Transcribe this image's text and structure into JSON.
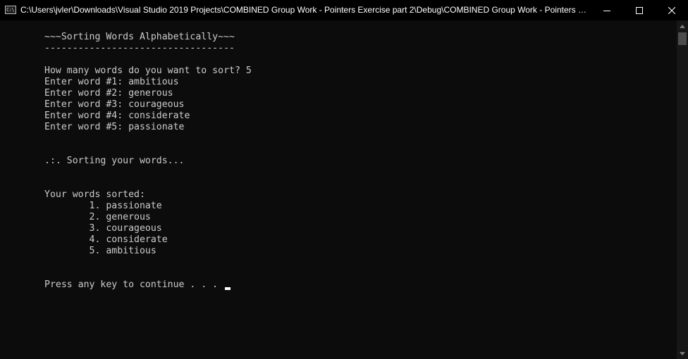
{
  "window": {
    "title": "C:\\Users\\jvler\\Downloads\\Visual Studio 2019 Projects\\COMBINED Group Work - Pointers Exercise part 2\\Debug\\COMBINED Group Work - Pointers Exer...",
    "icon_text": "C:\\",
    "minimize_icon": "minimize-icon",
    "maximize_icon": "maximize-icon",
    "close_icon": "close-icon"
  },
  "console": {
    "lines": [
      "~~~Sorting Words Alphabetically~~~",
      "----------------------------------",
      "",
      "How many words do you want to sort? 5",
      "Enter word #1: ambitious",
      "Enter word #2: generous",
      "Enter word #3: courageous",
      "Enter word #4: considerate",
      "Enter word #5: passionate",
      "",
      "",
      ".:. Sorting your words...",
      "",
      "",
      "Your words sorted:",
      "        1. passionate",
      "        2. generous",
      "        3. courageous",
      "        4. considerate",
      "        5. ambitious",
      "",
      "",
      "Press any key to continue . . . "
    ]
  },
  "colors": {
    "background": "#0c0c0c",
    "text": "#cccccc",
    "titlebar": "#000000"
  }
}
